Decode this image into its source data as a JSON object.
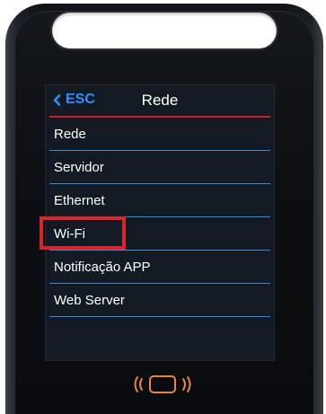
{
  "screen": {
    "back_label": "ESC",
    "title": "Rede"
  },
  "menu": {
    "items": [
      {
        "label": "Rede"
      },
      {
        "label": "Servidor"
      },
      {
        "label": "Ethernet"
      },
      {
        "label": "Wi-Fi"
      },
      {
        "label": "Notificação APP"
      },
      {
        "label": "Web Server"
      }
    ]
  },
  "colors": {
    "accent_blue": "#2f90ff",
    "header_line_red": "#c8202a",
    "highlight_red": "#d9252b",
    "divider_blue": "#2f8fe0",
    "nfc_orange": "#e8873a"
  },
  "icons": {
    "back": "chevron-left-icon",
    "nfc": "nfc-reader-icon"
  }
}
